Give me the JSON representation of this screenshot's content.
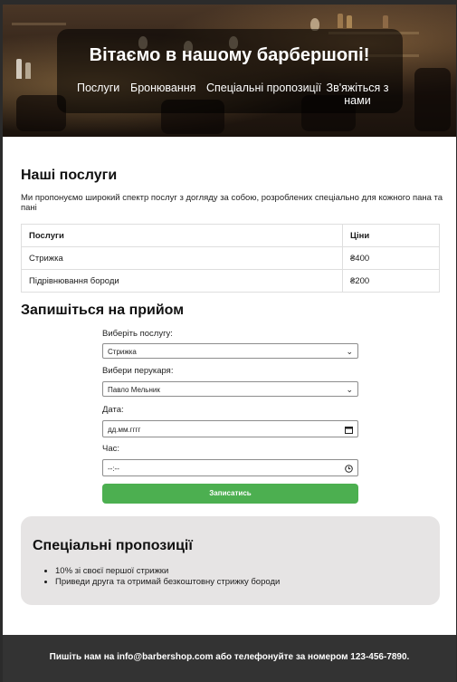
{
  "hero": {
    "title": "Вітаємо в нашому барбершопі!",
    "nav": [
      {
        "label": "Послуги"
      },
      {
        "label": "Бронювання"
      },
      {
        "label": "Спеціальні пропозиції"
      },
      {
        "label": "Зв'яжіться з нами"
      }
    ]
  },
  "services": {
    "heading": "Наші послуги",
    "intro": "Ми пропонуємо широкий спектр послуг з догляду за собою, розроблених спеціально для кожного пана та пані",
    "columns": [
      "Послуги",
      "Ціни"
    ],
    "rows": [
      {
        "service": "Стрижка",
        "price": "₴400"
      },
      {
        "service": "Підрівнювання бороди",
        "price": "₴200"
      }
    ]
  },
  "booking": {
    "heading": "Запишіться на прийом",
    "service_label": "Виберіть послугу:",
    "service_value": "Стрижка",
    "barber_label": "Вибери перукаря:",
    "barber_value": "Павло Мельник",
    "date_label": "Дата:",
    "date_placeholder": "дд.мм.гггг",
    "time_label": "Час:",
    "time_placeholder": "--:--",
    "submit_label": "Записатись"
  },
  "offers": {
    "heading": "Спеціальні пропозиції",
    "items": [
      "10% зі своєї першої стрижки",
      "Приведи друга та отримай безкоштовну стрижку бороди"
    ]
  },
  "footer": {
    "text": "Пишіть нам на info@barbershop.com або телефонуйте за номером 123-456-7890."
  },
  "colors": {
    "page_bg": "#2b2b2b",
    "button": "#4caf50",
    "offers_bg": "#e6e4e4",
    "footer_bg": "#333333"
  }
}
